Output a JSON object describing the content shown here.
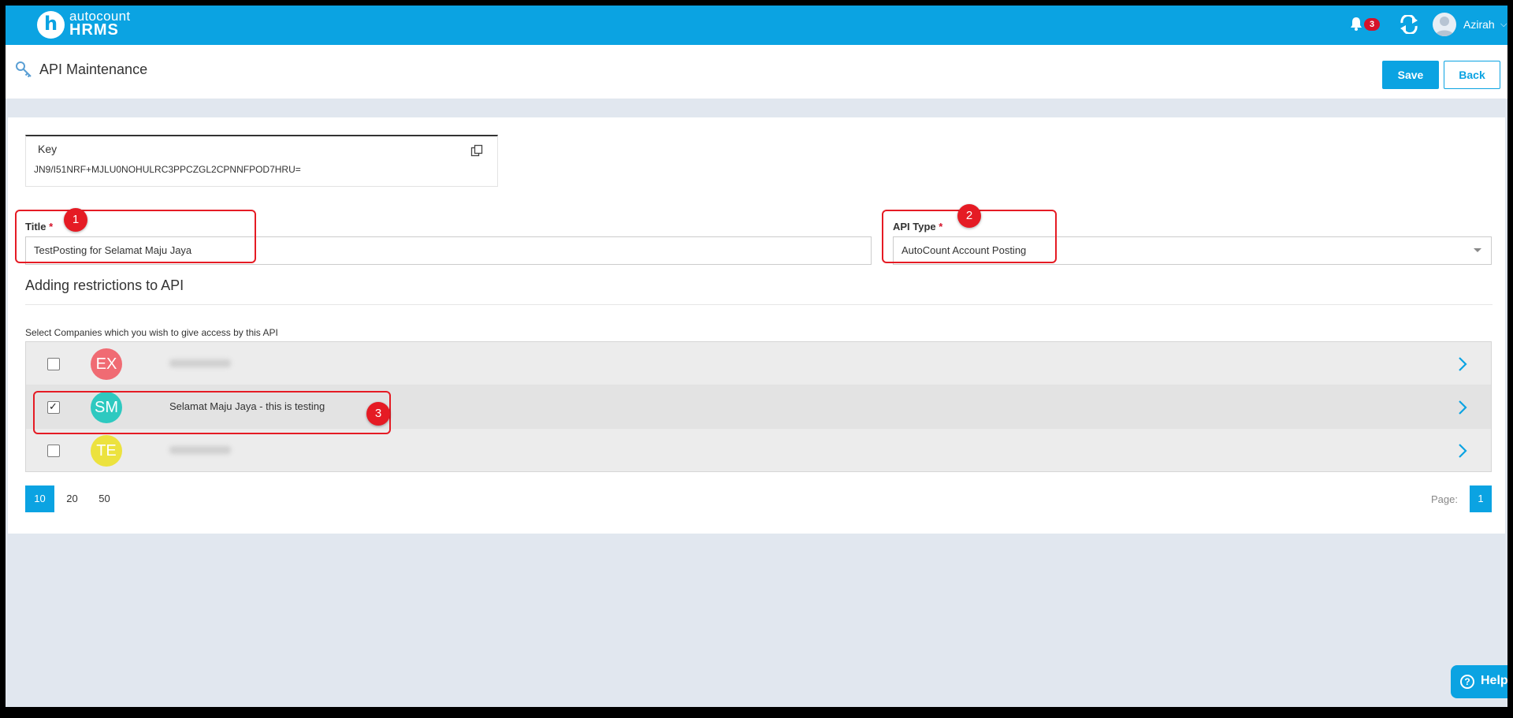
{
  "app": {
    "logo_small": "autocount",
    "logo_large": "HRMS",
    "notification_count": "3",
    "username": "Azirah"
  },
  "header": {
    "title": "API Maintenance",
    "save_label": "Save",
    "back_label": "Back"
  },
  "form": {
    "key_label": "Key",
    "key_value": "JN9/I51NRF+MJLU0NOHULRC3PPCZGL2CPNNFPOD7HRU=",
    "title_label": "Title",
    "title_value": "TestPosting for Selamat Maju Jaya",
    "api_type_label": "API Type",
    "api_type_value": "AutoCount Account Posting",
    "required_marker": "*"
  },
  "restrictions": {
    "section_title": "Adding restrictions to API",
    "hint": "Select Companies which you wish to give access by this API",
    "companies": [
      {
        "initials": "EX",
        "name": "",
        "checked": false,
        "color": "#f06b73"
      },
      {
        "initials": "SM",
        "name": "Selamat Maju Jaya - this is testing",
        "checked": true,
        "color": "#2ec9c0"
      },
      {
        "initials": "TE",
        "name": "",
        "checked": false,
        "color": "#ece23e"
      }
    ]
  },
  "pager": {
    "sizes": [
      "10",
      "20",
      "50"
    ],
    "active_size": "10",
    "page_label": "Page:",
    "current_page": "1"
  },
  "annotations": [
    "1",
    "2",
    "3"
  ],
  "help": {
    "label": "Help"
  },
  "colors": {
    "accent": "#0ba3e2",
    "annotation": "#e51b24",
    "badge": "#d5132b"
  }
}
